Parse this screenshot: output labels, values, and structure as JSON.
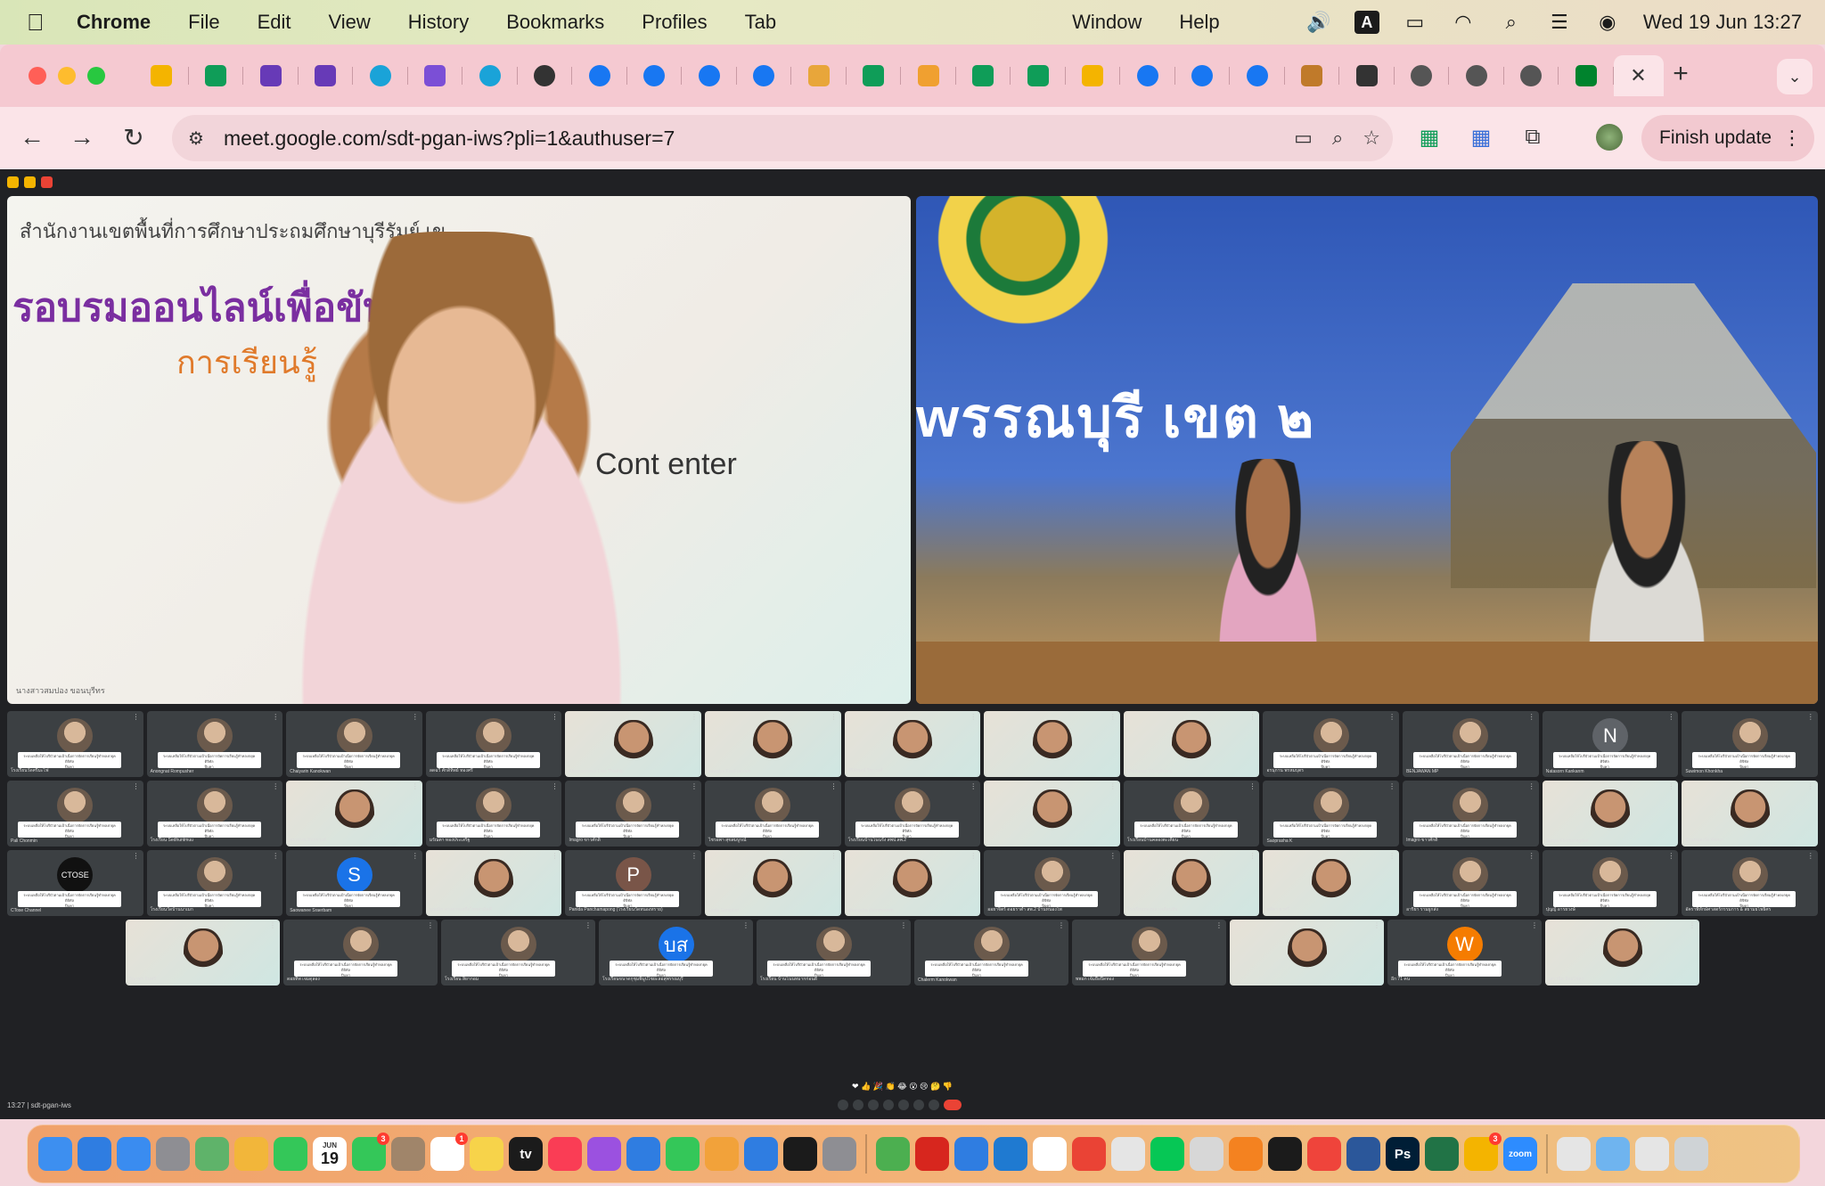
{
  "menubar": {
    "app": "Chrome",
    "items": [
      "File",
      "Edit",
      "View",
      "History",
      "Bookmarks",
      "Profiles",
      "Tab",
      "Window",
      "Help"
    ],
    "input_indicator": "A",
    "clock": "Wed 19 Jun  13:27"
  },
  "browser": {
    "url": "meet.google.com/sdt-pgan-iws?pli=1&authuser=7",
    "finish_update": "Finish update",
    "new_tab": "+",
    "close_tab": "✕",
    "tabs": [
      {
        "icon": "google-drive-icon",
        "color": "#f4b400"
      },
      {
        "icon": "google-drive-icon",
        "color": "#0f9d58"
      },
      {
        "icon": "google-forms-icon",
        "color": "#673ab7"
      },
      {
        "icon": "google-forms-icon",
        "color": "#673ab7"
      },
      {
        "icon": "canva-icon",
        "color": "#1aa3d8"
      },
      {
        "icon": "chat-icon",
        "color": "#7b4fd6"
      },
      {
        "icon": "canva-icon",
        "color": "#1aa3d8"
      },
      {
        "icon": "github-icon",
        "color": "#333333"
      },
      {
        "icon": "facebook-icon",
        "color": "#1877f2"
      },
      {
        "icon": "facebook-icon",
        "color": "#1877f2"
      },
      {
        "icon": "facebook-icon",
        "color": "#1877f2"
      },
      {
        "icon": "facebook-icon",
        "color": "#1877f2"
      },
      {
        "icon": "cg-icon",
        "color": "#e8a63a"
      },
      {
        "icon": "google-drive-icon",
        "color": "#0f9d58"
      },
      {
        "icon": "ebook-icon",
        "color": "#f0a030"
      },
      {
        "icon": "google-drive-icon",
        "color": "#0f9d58"
      },
      {
        "icon": "google-drive-icon",
        "color": "#0f9d58"
      },
      {
        "icon": "google-drive-icon",
        "color": "#f4b400"
      },
      {
        "icon": "facebook-icon",
        "color": "#1877f2"
      },
      {
        "icon": "facebook-icon",
        "color": "#1877f2"
      },
      {
        "icon": "facebook-icon",
        "color": "#1877f2"
      },
      {
        "icon": "fire-icon",
        "color": "#c07a2a"
      },
      {
        "icon": "download-icon",
        "color": "#333333"
      },
      {
        "icon": "globe-icon",
        "color": "#555555"
      },
      {
        "icon": "globe-icon",
        "color": "#555555"
      },
      {
        "icon": "globe-icon",
        "color": "#555555"
      },
      {
        "icon": "meet-icon",
        "color": "#00832d"
      }
    ]
  },
  "meet": {
    "meeting_code": "sdt-pgan-iws",
    "time": "13:27",
    "presenter1": {
      "banner_office": "สำนักงานเขตพื้นที่การศึกษาประถมศึกษาบุรีรัมย์ เข",
      "banner_main": "รอบรมออนไลน์เพื่อขับเคลื่อน",
      "banner_sub": "การเรียนรู้",
      "banner_center": "Cont   enter",
      "caption": "นางสาวสมปอง ขอนบุรีทร"
    },
    "presenter2": {
      "title": "wรรณบุรี เขต ๒"
    },
    "slide_line1": "ระบบเหลือให้โบรีบัวตามเป้าเนื่อการจัดการเรียนรู้ทำหลงกยุคดิจิทัล",
    "slide_line2": "ปีบุคา",
    "participants": [
      {
        "name": "โรงเรียนวัดศรีมะไฟ",
        "initial": ""
      },
      {
        "name": "Anongnat Rompusher",
        "initial": ""
      },
      {
        "name": "Chaiyarin Kanokwan",
        "initial": ""
      },
      {
        "name": "ลดฉวี ศักดิ์ทิพย์ ทองศรี",
        "initial": ""
      },
      {
        "name": "Khomoemeen Lam Thiathip",
        "initial": ""
      },
      {
        "name": "suwalya Kasikranram",
        "initial": ""
      },
      {
        "name": "ศิริลักษณ์ วิชาวงศ์",
        "initial": ""
      },
      {
        "name": "",
        "initial": ""
      },
      {
        "name": "Chintanan Wongthiang",
        "initial": ""
      },
      {
        "name": "อรนุกาน พรหมบุตร",
        "initial": ""
      },
      {
        "name": "BENJAWAN MP",
        "initial": ""
      },
      {
        "name": "Natasorn Kankanm",
        "initial": "N"
      },
      {
        "name": "Suwimon Khonkha",
        "initial": ""
      },
      {
        "name": "Pali Chonmin",
        "initial": ""
      },
      {
        "name": "โรงเรียน Sedhuntmuu",
        "initial": ""
      },
      {
        "name": "อรวรรณ อินทรวงศ์",
        "initial": ""
      },
      {
        "name": "มรัณตา ทองประเสริฐ",
        "initial": ""
      },
      {
        "name": "Imagro ขาวศักดิ์",
        "initial": ""
      },
      {
        "name": "ไชรอพา สุขสมบูรณ์",
        "initial": ""
      },
      {
        "name": "โรงเรียนบ้านโนนรัง สพป.ลพ.2",
        "initial": ""
      },
      {
        "name": "",
        "initial": ""
      },
      {
        "name": "โรงเรียนบ้านคลองตะเคียน",
        "initial": ""
      },
      {
        "name": "Saoprasha K",
        "initial": ""
      },
      {
        "name": "Imagro ขาวศักดิ์",
        "initial": ""
      },
      {
        "name": "Suriya Khomsongdee",
        "initial": ""
      },
      {
        "name": "บ้านหนองไผ่ พัฒนา",
        "initial": ""
      },
      {
        "name": "CTose Channel",
        "initial": "CTOSE"
      },
      {
        "name": "โรงเรียนวัดบ้านนาเมก",
        "initial": ""
      },
      {
        "name": "Saowanee Sraerbam",
        "initial": "S"
      },
      {
        "name": "บุณณิก ดวงตามเสถือไทยสามัคคี",
        "initial": ""
      },
      {
        "name": "Panida Panchamapong (โรงเรียนวัดหนองทราย)",
        "initial": "P"
      },
      {
        "name": "Linda Saraphat",
        "initial": ""
      },
      {
        "name": "phongcha chonmooom",
        "initial": ""
      },
      {
        "name": "ออยาจิตร์ ดอยราตำ สพ.2 บ้านหนองโพ",
        "initial": ""
      },
      {
        "name": "โรงเรียนทองหลางเดือนสิบ",
        "initial": ""
      },
      {
        "name": "ชลิตา ยาศรี",
        "initial": ""
      },
      {
        "name": "อาริยา รามผูกส่ง",
        "initial": ""
      },
      {
        "name": "ปุญญ์ อารยวงษ์",
        "initial": ""
      },
      {
        "name": "อัคราพิทักษ์ศาสตร์กรรมการ & สยามยโพธิ์ศร",
        "initial": ""
      },
      {
        "name": "วีณาพร อินทรี",
        "initial": ""
      },
      {
        "name": "ดอยทิพ เจมดุลอง",
        "initial": ""
      },
      {
        "name": "โรงเรียน สิยากอม",
        "initial": ""
      },
      {
        "name": "โรงเรียนขนาดกุชุมพิมูปไชยะลอสุพรรณบุรี",
        "initial": "บส"
      },
      {
        "name": "โรงเรียน บ้านโนนหมากก่อนดี",
        "initial": ""
      },
      {
        "name": "Chalerm Kanokwan",
        "initial": ""
      },
      {
        "name": "พพอก เจ้มยือปิดทอง",
        "initial": ""
      },
      {
        "name": "",
        "initial": ""
      },
      {
        "name": "อีก 71 คน",
        "initial": "W"
      },
      {
        "name": "เสาวนีย ป้อมไชสง",
        "initial": ""
      }
    ]
  },
  "dock": {
    "calendar_month": "JUN",
    "calendar_day": "19",
    "messages_badge": "3",
    "reminders_badge": "1",
    "app_badge": "3",
    "apps": [
      {
        "name": "finder-icon",
        "color": "#3d8ff0"
      },
      {
        "name": "safari-icon",
        "color": "#2f7de1"
      },
      {
        "name": "mail-icon",
        "color": "#3a8cf0"
      },
      {
        "name": "launchpad-icon",
        "color": "#8e8e93"
      },
      {
        "name": "maps-icon",
        "color": "#5fb36a"
      },
      {
        "name": "photos-icon",
        "color": "#f2b63a"
      },
      {
        "name": "facetime-icon",
        "color": "#34c759"
      },
      {
        "name": "calendar-icon",
        "color": "#ffffff"
      },
      {
        "name": "messages-icon",
        "color": "#34c759"
      },
      {
        "name": "contacts-icon",
        "color": "#a0856a"
      },
      {
        "name": "reminders-icon",
        "color": "#ffffff"
      },
      {
        "name": "notes-icon",
        "color": "#f7d34a"
      },
      {
        "name": "tv-icon",
        "color": "#1b1b1b"
      },
      {
        "name": "music-icon",
        "color": "#fa3d55"
      },
      {
        "name": "podcasts-icon",
        "color": "#9b51e0"
      },
      {
        "name": "keynote-icon",
        "color": "#2f7de1"
      },
      {
        "name": "numbers-icon",
        "color": "#34c759"
      },
      {
        "name": "pages-icon",
        "color": "#f2a23a"
      },
      {
        "name": "app-store-icon",
        "color": "#2f7de1"
      },
      {
        "name": "quicktime-icon",
        "color": "#1b1b1b"
      },
      {
        "name": "system-settings-icon",
        "color": "#8e8e93"
      },
      {
        "name": "vectorize-icon",
        "color": "#4caf50"
      },
      {
        "name": "acrobat-icon",
        "color": "#d7261e"
      },
      {
        "name": "bluetooth-icon",
        "color": "#2f7de1"
      },
      {
        "name": "vscode-icon",
        "color": "#1f7ad1"
      },
      {
        "name": "chess-icon",
        "color": "#ffffff"
      },
      {
        "name": "chrome-icon",
        "color": "#ea4335"
      },
      {
        "name": "script-editor-icon",
        "color": "#e5e5e5"
      },
      {
        "name": "line-icon",
        "color": "#06c755"
      },
      {
        "name": "preview-icon",
        "color": "#d7d7d7"
      },
      {
        "name": "vlc-icon",
        "color": "#f48220"
      },
      {
        "name": "activity-monitor-icon",
        "color": "#1b1b1b"
      },
      {
        "name": "anydesk-icon",
        "color": "#ef443b"
      },
      {
        "name": "word-icon",
        "color": "#2b579a"
      },
      {
        "name": "photoshop-icon",
        "color": "#001e36"
      },
      {
        "name": "excel-icon",
        "color": "#217346"
      },
      {
        "name": "app-icon",
        "color": "#f4b400"
      },
      {
        "name": "zoom-icon",
        "color": "#2d8cff"
      },
      {
        "name": "document-icon",
        "color": "#e5e5e5"
      },
      {
        "name": "folder-icon",
        "color": "#6fb4ef"
      },
      {
        "name": "preview-doc-icon",
        "color": "#e5e5e5"
      },
      {
        "name": "trash-icon",
        "color": "#cfd3d6"
      }
    ],
    "app_labels": {
      "tv": "tv",
      "ps": "Ps",
      "zoom": "zoom"
    }
  }
}
